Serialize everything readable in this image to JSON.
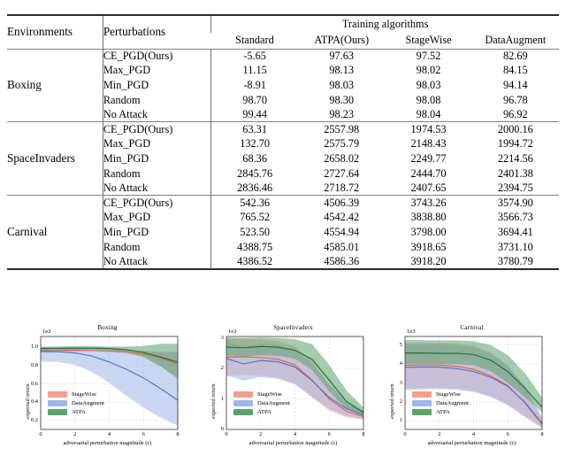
{
  "table": {
    "headers": {
      "environments": "Environments",
      "perturbations": "Perturbations",
      "group": "Training algorithms",
      "cols": [
        "Standard",
        "ATPA(Ours)",
        "StageWise",
        "DataAugment"
      ]
    },
    "groups": [
      {
        "environment": "Boxing",
        "rows": [
          {
            "perturbation": "CE_PGD(Ours)",
            "values": [
              "-5.65",
              "97.63",
              "97.52",
              "82.69"
            ],
            "bold": [
              false,
              true,
              false,
              false
            ]
          },
          {
            "perturbation": "Max_PGD",
            "values": [
              "11.15",
              "98.13",
              "98.02",
              "84.15"
            ],
            "bold": [
              false,
              true,
              false,
              false
            ]
          },
          {
            "perturbation": "Min_PGD",
            "values": [
              "-8.91",
              "98.03",
              "98.03",
              "94.14"
            ],
            "bold": [
              false,
              true,
              false,
              false
            ]
          },
          {
            "perturbation": "Random",
            "values": [
              "98.70",
              "98.30",
              "98.08",
              "96.78"
            ],
            "bold": [
              true,
              false,
              false,
              false
            ]
          },
          {
            "perturbation": "No Attack",
            "values": [
              "99.44",
              "98.23",
              "98.04",
              "96.92"
            ],
            "bold": [
              true,
              false,
              false,
              false
            ]
          }
        ]
      },
      {
        "environment": "SpaceInvaders",
        "rows": [
          {
            "perturbation": "CE_PGD(Ours)",
            "values": [
              "63.31",
              "2557.98",
              "1974.53",
              "2000.16"
            ],
            "bold": [
              false,
              true,
              false,
              false
            ]
          },
          {
            "perturbation": "Max_PGD",
            "values": [
              "132.70",
              "2575.79",
              "2148.43",
              "1994.72"
            ],
            "bold": [
              false,
              true,
              false,
              false
            ]
          },
          {
            "perturbation": "Min_PGD",
            "values": [
              "68.36",
              "2658.02",
              "2249.77",
              "2214.56"
            ],
            "bold": [
              false,
              true,
              false,
              false
            ]
          },
          {
            "perturbation": "Random",
            "values": [
              "2845.76",
              "2727.64",
              "2444.70",
              "2401.38"
            ],
            "bold": [
              true,
              false,
              false,
              false
            ]
          },
          {
            "perturbation": "No Attack",
            "values": [
              "2836.46",
              "2718.72",
              "2407.65",
              "2394.75"
            ],
            "bold": [
              true,
              false,
              false,
              false
            ]
          }
        ]
      },
      {
        "environment": "Carnival",
        "rows": [
          {
            "perturbation": "CE_PGD(Ours)",
            "values": [
              "542.36",
              "4506.39",
              "3743.26",
              "3574.90"
            ],
            "bold": [
              false,
              true,
              false,
              false
            ]
          },
          {
            "perturbation": "Max_PGD",
            "values": [
              "765.52",
              "4542.42",
              "3838.80",
              "3566.73"
            ],
            "bold": [
              false,
              true,
              false,
              false
            ]
          },
          {
            "perturbation": "Min_PGD",
            "values": [
              "523.50",
              "4554.94",
              "3798.00",
              "3694.41"
            ],
            "bold": [
              false,
              true,
              false,
              false
            ]
          },
          {
            "perturbation": "Random",
            "values": [
              "4388.75",
              "4585.01",
              "3918.65",
              "3731.10"
            ],
            "bold": [
              false,
              true,
              false,
              false
            ]
          },
          {
            "perturbation": "No Attack",
            "values": [
              "4386.52",
              "4586.36",
              "3918.20",
              "3780.79"
            ],
            "bold": [
              false,
              true,
              false,
              false
            ]
          }
        ]
      }
    ]
  },
  "colors": {
    "stagewise_fill": "#f4a08a",
    "stagewise_line": "#e8603c",
    "dataaugment_fill": "#9fb6e8",
    "dataaugment_line": "#4a6fc4",
    "atpa_fill": "#5aa36b",
    "atpa_line": "#1d6b2e",
    "axis": "#333333",
    "grid": "#d8d8d8"
  },
  "chart_data": [
    {
      "type": "area",
      "title": "Boxing",
      "xlabel": "adversarial perturbation magnitude (ε)",
      "ylabel": "expected return",
      "y_exponent": "1e2",
      "x": [
        0,
        1,
        2,
        3,
        4,
        5,
        6,
        7,
        8
      ],
      "xlim": [
        0,
        8
      ],
      "ylim": [
        0.1,
        1.12
      ],
      "xticks": [
        0,
        2,
        4,
        6,
        8
      ],
      "xticklabels": [
        "0",
        "2",
        "4",
        "6",
        "8"
      ],
      "yticks": [
        0.2,
        0.4,
        0.6,
        0.8,
        1.0
      ],
      "yticklabels": [
        "0.2",
        "0.4",
        "0.6",
        "0.8",
        "1.0"
      ],
      "grid": true,
      "legend_position": "lower left",
      "series": [
        {
          "name": "StageWise",
          "mean": [
            0.965,
            0.967,
            0.968,
            0.967,
            0.962,
            0.95,
            0.928,
            0.885,
            0.818
          ],
          "lower": [
            0.952,
            0.954,
            0.955,
            0.953,
            0.946,
            0.93,
            0.896,
            0.8,
            0.64
          ],
          "upper": [
            0.978,
            0.98,
            0.981,
            0.98,
            0.977,
            0.97,
            0.962,
            0.955,
            0.948
          ]
        },
        {
          "name": "DataAugment",
          "mean": [
            0.955,
            0.952,
            0.94,
            0.905,
            0.84,
            0.76,
            0.665,
            0.548,
            0.42
          ],
          "lower": [
            0.845,
            0.84,
            0.81,
            0.73,
            0.61,
            0.47,
            0.34,
            0.23,
            0.14
          ],
          "upper": [
            1.01,
            1.01,
            1.008,
            1.0,
            0.99,
            0.975,
            0.96,
            0.95,
            0.945
          ]
        },
        {
          "name": "ATPA",
          "mean": [
            0.988,
            0.99,
            0.992,
            0.992,
            0.988,
            0.975,
            0.945,
            0.895,
            0.838
          ],
          "lower": [
            0.962,
            0.966,
            0.972,
            0.975,
            0.968,
            0.945,
            0.895,
            0.79,
            0.665
          ],
          "upper": [
            1.005,
            1.008,
            1.012,
            1.012,
            1.01,
            1.008,
            1.015,
            1.04,
            1.04
          ]
        }
      ]
    },
    {
      "type": "area",
      "title": "SpaceInvaders",
      "xlabel": "adversarial perturbation magnitude (ε)",
      "ylabel": "expected return",
      "y_exponent": "1e3",
      "x": [
        0,
        1,
        2,
        3,
        4,
        5,
        6,
        7,
        8
      ],
      "xlim": [
        0,
        8
      ],
      "ylim": [
        0,
        3.05
      ],
      "xticks": [
        0,
        2,
        4,
        6,
        8
      ],
      "xticklabels": [
        "0",
        "2",
        "4",
        "6",
        "8"
      ],
      "yticks": [
        0,
        1,
        2,
        3
      ],
      "yticklabels": [
        "0",
        "1",
        "2",
        "3"
      ],
      "grid": true,
      "legend_position": "lower left",
      "series": [
        {
          "name": "StageWise",
          "mean": [
            2.37,
            2.38,
            2.36,
            2.3,
            2.12,
            1.62,
            1.0,
            0.6,
            0.42
          ],
          "lower": [
            1.75,
            1.78,
            1.76,
            1.7,
            1.5,
            1.05,
            0.62,
            0.4,
            0.32
          ],
          "upper": [
            2.98,
            2.98,
            2.96,
            2.9,
            2.72,
            2.25,
            1.45,
            0.85,
            0.58
          ]
        },
        {
          "name": "DataAugment",
          "mean": [
            2.33,
            2.15,
            2.26,
            2.22,
            2.05,
            1.6,
            1.05,
            0.68,
            0.48
          ],
          "lower": [
            1.78,
            1.6,
            1.72,
            1.66,
            1.48,
            1.08,
            0.68,
            0.44,
            0.35
          ],
          "upper": [
            2.9,
            2.72,
            2.82,
            2.78,
            2.62,
            2.16,
            1.48,
            0.95,
            0.63
          ]
        },
        {
          "name": "ATPA",
          "mean": [
            2.7,
            2.68,
            2.72,
            2.7,
            2.6,
            2.3,
            1.62,
            0.92,
            0.55
          ],
          "lower": [
            2.42,
            2.38,
            2.44,
            2.42,
            2.32,
            1.95,
            1.25,
            0.68,
            0.42
          ],
          "upper": [
            3.02,
            3.0,
            3.02,
            3.0,
            2.96,
            2.8,
            2.12,
            1.28,
            0.72
          ]
        }
      ]
    },
    {
      "type": "area",
      "title": "Carnival",
      "xlabel": "adversarial perturbation magnitude (ε)",
      "ylabel": "expected return",
      "y_exponent": "1e3",
      "x": [
        0,
        1,
        2,
        3,
        4,
        5,
        6,
        7,
        8
      ],
      "xlim": [
        0,
        8
      ],
      "ylim": [
        0.55,
        5.45
      ],
      "xticks": [
        0,
        2,
        4,
        6,
        8
      ],
      "xticklabels": [
        "0",
        "2",
        "4",
        "6",
        "8"
      ],
      "yticks": [
        1,
        2,
        3,
        4,
        5
      ],
      "yticklabels": [
        "1",
        "2",
        "3",
        "4",
        "5"
      ],
      "grid": true,
      "legend_position": "lower left",
      "series": [
        {
          "name": "StageWise",
          "mean": [
            3.93,
            3.94,
            3.94,
            3.88,
            3.72,
            3.38,
            2.85,
            1.95,
            0.8
          ],
          "lower": [
            2.7,
            2.72,
            2.74,
            2.7,
            2.58,
            2.3,
            1.85,
            1.2,
            0.62
          ],
          "upper": [
            5.1,
            5.12,
            5.12,
            5.08,
            4.96,
            4.62,
            3.92,
            2.8,
            1.1
          ]
        },
        {
          "name": "DataAugment",
          "mean": [
            3.82,
            3.84,
            3.83,
            3.76,
            3.6,
            3.3,
            2.82,
            1.98,
            0.86
          ],
          "lower": [
            2.62,
            2.66,
            2.68,
            2.64,
            2.52,
            2.26,
            1.82,
            1.24,
            0.66
          ],
          "upper": [
            5.02,
            5.04,
            5.04,
            4.98,
            4.86,
            4.52,
            3.88,
            2.84,
            1.18
          ]
        },
        {
          "name": "ATPA",
          "mean": [
            4.58,
            4.58,
            4.56,
            4.56,
            4.5,
            4.2,
            3.6,
            2.72,
            1.72
          ],
          "lower": [
            3.98,
            4.0,
            4.0,
            4.0,
            3.94,
            3.62,
            3.0,
            2.26,
            1.45
          ],
          "upper": [
            5.26,
            5.26,
            5.24,
            5.24,
            5.2,
            5.0,
            4.46,
            3.52,
            2.22
          ]
        }
      ]
    }
  ]
}
